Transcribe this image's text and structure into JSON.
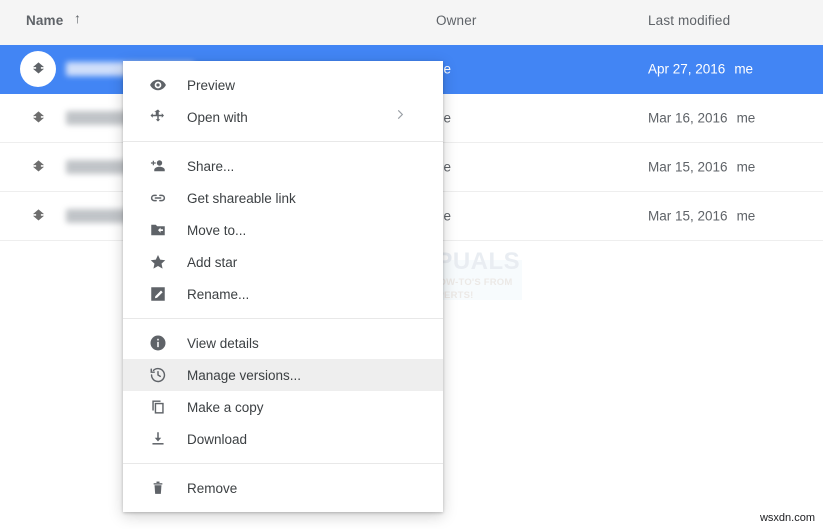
{
  "colors": {
    "accent_blue": "#4285f4",
    "header_bg": "#f5f5f5",
    "row_divider": "#eeeeee",
    "text_secondary": "#5f6368",
    "text_primary": "#3c4043",
    "menu_highlight": "#eeeeee"
  },
  "columns": {
    "name": "Name",
    "name_sort_icon": "sort-ascending-arrow-icon",
    "name_sort_glyph": "↑",
    "owner": "Owner",
    "last_modified": "Last modified"
  },
  "rows": [
    {
      "icon": "file-icon",
      "name_redacted": true,
      "name_width": 128,
      "owner": "me",
      "owner_visible_tail": "ne",
      "last_modified": "Apr 27, 2016",
      "modified_owner": "me",
      "selected": true
    },
    {
      "icon": "file-icon",
      "name_redacted": true,
      "name_width": 98,
      "owner": "me",
      "owner_visible_tail": "ne",
      "last_modified": "Mar 16, 2016",
      "modified_owner": "me",
      "selected": false
    },
    {
      "icon": "file-icon",
      "name_redacted": true,
      "name_width": 110,
      "owner": "me",
      "owner_visible_tail": "ne",
      "last_modified": "Mar 15, 2016",
      "modified_owner": "me",
      "selected": false
    },
    {
      "icon": "file-icon",
      "name_redacted": true,
      "name_width": 96,
      "owner": "me",
      "owner_visible_tail": "ne",
      "last_modified": "Mar 15, 2016",
      "modified_owner": "me",
      "selected": false
    }
  ],
  "context_menu": {
    "groups": [
      {
        "items": [
          {
            "icon": "eye-icon",
            "label": "Preview",
            "highlighted": false,
            "submenu": false
          },
          {
            "icon": "move-icon",
            "label": "Open with",
            "highlighted": false,
            "submenu": true,
            "submenu_glyph": "›"
          }
        ]
      },
      {
        "items": [
          {
            "icon": "person-add-icon",
            "label": "Share...",
            "highlighted": false,
            "submenu": false
          },
          {
            "icon": "link-icon",
            "label": "Get shareable link",
            "highlighted": false,
            "submenu": false
          },
          {
            "icon": "folder-move-icon",
            "label": "Move to...",
            "highlighted": false,
            "submenu": false
          },
          {
            "icon": "star-icon",
            "label": "Add star",
            "highlighted": false,
            "submenu": false
          },
          {
            "icon": "pencil-icon",
            "label": "Rename...",
            "highlighted": false,
            "submenu": false
          }
        ]
      },
      {
        "items": [
          {
            "icon": "info-icon",
            "label": "View details",
            "highlighted": false,
            "submenu": false
          },
          {
            "icon": "history-icon",
            "label": "Manage versions...",
            "highlighted": true,
            "submenu": false
          },
          {
            "icon": "copy-icon",
            "label": "Make a copy",
            "highlighted": false,
            "submenu": false
          },
          {
            "icon": "download-icon",
            "label": "Download",
            "highlighted": false,
            "submenu": false
          }
        ]
      },
      {
        "items": [
          {
            "icon": "trash-icon",
            "label": "Remove",
            "highlighted": false,
            "submenu": false
          }
        ]
      }
    ]
  },
  "watermark": {
    "title": "APPUALS",
    "subtitle_line1": "TECH HOW-TO'S FROM",
    "subtitle_line2": "THE EXPERTS!",
    "illustration": "man-at-laptop-illustration"
  },
  "site_credit": "wsxdn.com"
}
